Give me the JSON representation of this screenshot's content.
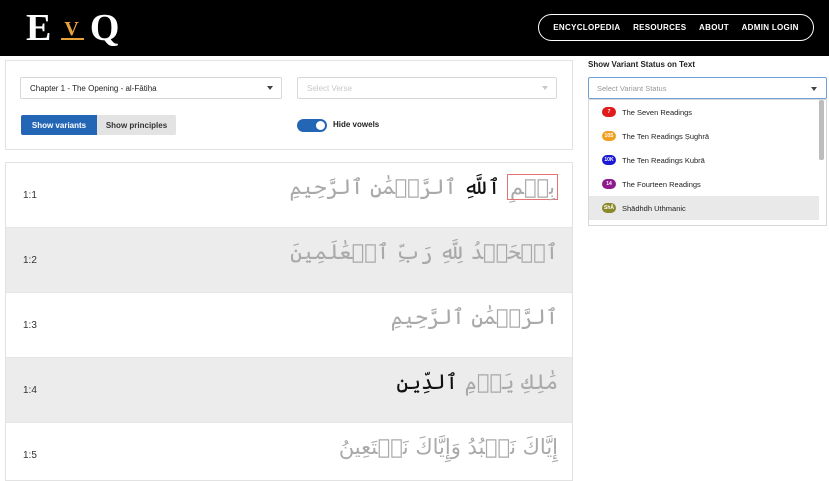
{
  "header": {
    "logo_left": "E",
    "logo_mid": "V",
    "logo_right": "Q",
    "nav": [
      "ENCYCLOPEDIA",
      "RESOURCES",
      "ABOUT",
      "ADMIN LOGIN"
    ]
  },
  "controls": {
    "chapter_value": "Chapter 1 - The Opening - al-Fātiḥa",
    "verse_placeholder": "Select Verse",
    "show_variants": "Show variants",
    "show_principles": "Show principles",
    "hide_vowels_label": "Hide vowels",
    "hide_vowels_on": true
  },
  "verses": [
    {
      "num": "1:1",
      "words": [
        {
          "t": "بِسۡمِ",
          "s": "box"
        },
        {
          "t": " ٱللَّهِ",
          "s": "hl"
        },
        {
          "t": " ٱلرَّحۡمَٰنِ ٱلرَّحِيمِ",
          "s": ""
        }
      ]
    },
    {
      "num": "1:2",
      "words": [
        {
          "t": "ٱلۡحَمۡدُ لِلَّهِ رَبِّ ٱلۡعَٰلَمِينَ",
          "s": ""
        }
      ]
    },
    {
      "num": "1:3",
      "words": [
        {
          "t": "ٱلرَّحۡمَٰنِ ٱلرَّحِيمِ",
          "s": ""
        }
      ]
    },
    {
      "num": "1:4",
      "words": [
        {
          "t": "مَٰلِكِ يَوۡمِ",
          "s": ""
        },
        {
          "t": " ٱلدِّينِ",
          "s": "hl"
        }
      ]
    },
    {
      "num": "1:5",
      "words": [
        {
          "t": "إِيَّاكَ نَعۡبُدُ وَإِيَّاكَ نَسۡتَعِينُ",
          "s": ""
        }
      ]
    }
  ],
  "variant_status": {
    "title": "Show Variant Status on Text",
    "placeholder": "Select Variant Status",
    "options": [
      {
        "badge": "7",
        "color": "#e01b1b",
        "label": "The Seven Readings"
      },
      {
        "badge": "10S",
        "color": "#f0a020",
        "label": "The Ten Readings Ṣughrā"
      },
      {
        "badge": "10K",
        "color": "#1a1ad6",
        "label": "The Ten Readings Kubrā"
      },
      {
        "badge": "14",
        "color": "#8e1a8e",
        "label": "The Fourteen Readings"
      },
      {
        "badge": "ShĀ",
        "color": "#8a8a2a",
        "label": "Shādhdh Uthmanic"
      }
    ]
  }
}
